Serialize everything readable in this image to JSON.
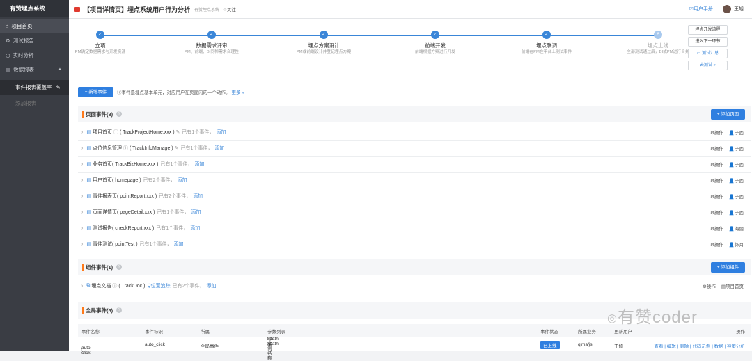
{
  "sidebar": {
    "brand": "有赞埋点系统",
    "items": [
      {
        "label": "项目首页"
      },
      {
        "label": "测试报告"
      },
      {
        "label": "实时分析"
      },
      {
        "label": "数据报表"
      }
    ],
    "subitems": [
      {
        "label": "事件报表覆盖率"
      },
      {
        "label": "添加报表"
      }
    ]
  },
  "topbar": {
    "title": "【项目详情页】埋点系统用户行为分析",
    "subtitle": "有赞埋点系统",
    "follow": "关注",
    "manual": "用户手册",
    "user": "王旭"
  },
  "steps": [
    {
      "label": "立项",
      "desc": "PM确定数据需求与开发资源"
    },
    {
      "label": "数据需求评审",
      "desc": "PM、前端、BI同称需求合理性"
    },
    {
      "label": "埋点方案设计",
      "desc": "PM或前端设计并登记埋点方案"
    },
    {
      "label": "前端开发",
      "desc": "前端根据方案进行开发"
    },
    {
      "label": "埋点联调",
      "desc": "前端在PM在平台上测试事件"
    },
    {
      "num": "6",
      "label": "埋点上线",
      "desc": "全部测试通过后，BI或PM进行合并"
    }
  ],
  "side_buttons": [
    "埋点开发流程",
    "进入下一环节",
    "测试汇总",
    "去测试 »"
  ],
  "toolbar": {
    "add_event": "+ 新增事件",
    "info": "事件是埋点基本单元，对应用户在页面内的一个动作。",
    "more": "更多 »"
  },
  "page_section": {
    "title": "页面事件(8)",
    "button": "+ 添加页面"
  },
  "page_events": [
    {
      "name": "项目首页",
      "code": "( TrackProjectHome.xxx )",
      "count": "已有1个事件，",
      "add": "添加",
      "op": "操作",
      "child": "子面",
      "info": true,
      "edit": true
    },
    {
      "name": "点位信息管理",
      "code": "( TrackInfoManage )",
      "count": "已有1个事件，",
      "add": "添加",
      "op": "操作",
      "child": "子面",
      "info": true,
      "edit": true
    },
    {
      "name": "业务首页",
      "code": "( TrackBizHome.xxx )",
      "count": "已有1个事件，",
      "add": "添加",
      "op": "操作",
      "child": "子面"
    },
    {
      "name": "用户首页",
      "code": "( homepage )",
      "count": "已有2个事件，",
      "add": "添加",
      "op": "操作",
      "child": "子面"
    },
    {
      "name": "事件报表页",
      "code": "( pointReport.xxx )",
      "count": "已有2个事件，",
      "add": "添加",
      "op": "操作",
      "child": "子面"
    },
    {
      "name": "页面详情页",
      "code": "( pageDetail.xxx )",
      "count": "已有1个事件，",
      "add": "添加",
      "op": "操作",
      "child": "子面"
    },
    {
      "name": "测试报告",
      "code": "( checkReport.xxx )",
      "count": "已有1个事件，",
      "add": "添加",
      "op": "操作",
      "child": "海丽"
    },
    {
      "name": "事件测试",
      "code": "( pointTest )",
      "count": "已有1个事件，",
      "add": "添加",
      "op": "操作",
      "child": "怀月"
    }
  ],
  "component_section": {
    "title": "组件事件(1)",
    "button": "+ 添加组件"
  },
  "component_events": [
    {
      "name": "埋点文档",
      "code": "( TrackDoc )",
      "loc": "位置追踪",
      "count": "已有2个事件，",
      "add": "添加",
      "op": "操作",
      "child": "项目首页"
    }
  ],
  "global_section": {
    "title": "全局事件(5)"
  },
  "global_table": {
    "headers": [
      "事件名称",
      "事件标识",
      "所属",
      "参数列表",
      "事件状态",
      "所属业务",
      "更新用户",
      "操作"
    ],
    "rows": [
      {
        "name": "auto click",
        "id": "auto_click",
        "belong": "全局事件",
        "params": [
          "title 案例名称",
          "xpath xpath"
        ],
        "status": "已上线",
        "biz": "qima/js",
        "user": "王旭",
        "ops": "查看 | 编辑 | 删除 | 代码示例 | 数据 | 神策分析"
      }
    ]
  },
  "watermark": "有赞coder"
}
